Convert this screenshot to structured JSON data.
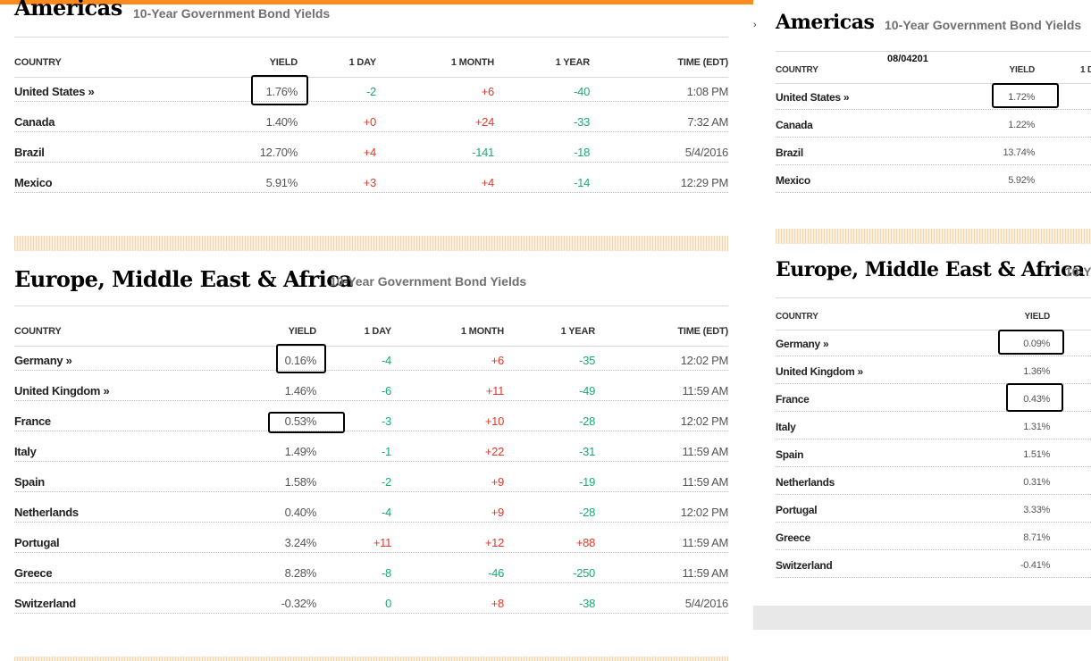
{
  "left": {
    "americas": {
      "title": "Americas",
      "subtitle": "10-Year Government Bond Yields",
      "headers": [
        "COUNTRY",
        "YIELD",
        "1 DAY",
        "1 MONTH",
        "1 YEAR",
        "TIME (EDT)"
      ],
      "rows": [
        {
          "country": "United States »",
          "yield": "1.76%",
          "day": "-2",
          "month": "+6",
          "year": "-40",
          "time": "1:08 PM"
        },
        {
          "country": "Canada",
          "yield": "1.40%",
          "day": "+0",
          "month": "+24",
          "year": "-33",
          "time": "7:32 AM"
        },
        {
          "country": "Brazil",
          "yield": "12.70%",
          "day": "+4",
          "month": "-141",
          "year": "-18",
          "time": "5/4/2016"
        },
        {
          "country": "Mexico",
          "yield": "5.91%",
          "day": "+3",
          "month": "+4",
          "year": "-14",
          "time": "12:29 PM"
        }
      ]
    },
    "emea": {
      "title": "Europe, Middle East & Africa",
      "subtitle": "10-Year Government Bond Yields",
      "headers": [
        "COUNTRY",
        "YIELD",
        "1 DAY",
        "1 MONTH",
        "1 YEAR",
        "TIME (EDT)"
      ],
      "rows": [
        {
          "country": "Germany »",
          "yield": "0.16%",
          "day": "-4",
          "month": "+6",
          "year": "-35",
          "time": "12:02 PM"
        },
        {
          "country": "United Kingdom »",
          "yield": "1.46%",
          "day": "-6",
          "month": "+11",
          "year": "-49",
          "time": "11:59 AM"
        },
        {
          "country": "France",
          "yield": "0.53%",
          "day": "-3",
          "month": "+10",
          "year": "-28",
          "time": "12:02 PM"
        },
        {
          "country": "Italy",
          "yield": "1.49%",
          "day": "-1",
          "month": "+22",
          "year": "-31",
          "time": "11:59 AM"
        },
        {
          "country": "Spain",
          "yield": "1.58%",
          "day": "-2",
          "month": "+9",
          "year": "-19",
          "time": "11:59 AM"
        },
        {
          "country": "Netherlands",
          "yield": "0.40%",
          "day": "-4",
          "month": "+9",
          "year": "-28",
          "time": "12:02 PM"
        },
        {
          "country": "Portugal",
          "yield": "3.24%",
          "day": "+11",
          "month": "+12",
          "year": "+88",
          "time": "11:59 AM"
        },
        {
          "country": "Greece",
          "yield": "8.28%",
          "day": "-8",
          "month": "-46",
          "year": "-250",
          "time": "11:59 AM"
        },
        {
          "country": "Switzerland",
          "yield": "-0.32%",
          "day": "0",
          "month": "+8",
          "year": "-38",
          "time": "5/4/2016"
        }
      ]
    }
  },
  "right": {
    "date_note": "08/04201",
    "americas": {
      "title": "Americas",
      "subtitle": "10-Year Government Bond Yields",
      "headers": [
        "COUNTRY",
        "YIELD",
        "1 D"
      ],
      "rows": [
        {
          "country": "United States »",
          "yield": "1.72%"
        },
        {
          "country": "Canada",
          "yield": "1.22%"
        },
        {
          "country": "Brazil",
          "yield": "13.74%"
        },
        {
          "country": "Mexico",
          "yield": "5.92%"
        }
      ]
    },
    "emea": {
      "title": "Europe, Middle East & Africa",
      "subtitle": "10-Y",
      "headers": [
        "COUNTRY",
        "YIELD"
      ],
      "rows": [
        {
          "country": "Germany »",
          "yield": "0.09%"
        },
        {
          "country": "United Kingdom »",
          "yield": "1.36%"
        },
        {
          "country": "France",
          "yield": "0.43%"
        },
        {
          "country": "Italy",
          "yield": "1.31%"
        },
        {
          "country": "Spain",
          "yield": "1.51%"
        },
        {
          "country": "Netherlands",
          "yield": "0.31%"
        },
        {
          "country": "Portugal",
          "yield": "3.33%"
        },
        {
          "country": "Greece",
          "yield": "8.71%"
        },
        {
          "country": "Switzerland",
          "yield": "-0.41%"
        }
      ]
    }
  },
  "colors": {
    "accent": "#fb8b1e",
    "up": "#e0392a",
    "down": "#1bab72"
  },
  "icons": {
    "more_link": "chevron-right-icon"
  }
}
